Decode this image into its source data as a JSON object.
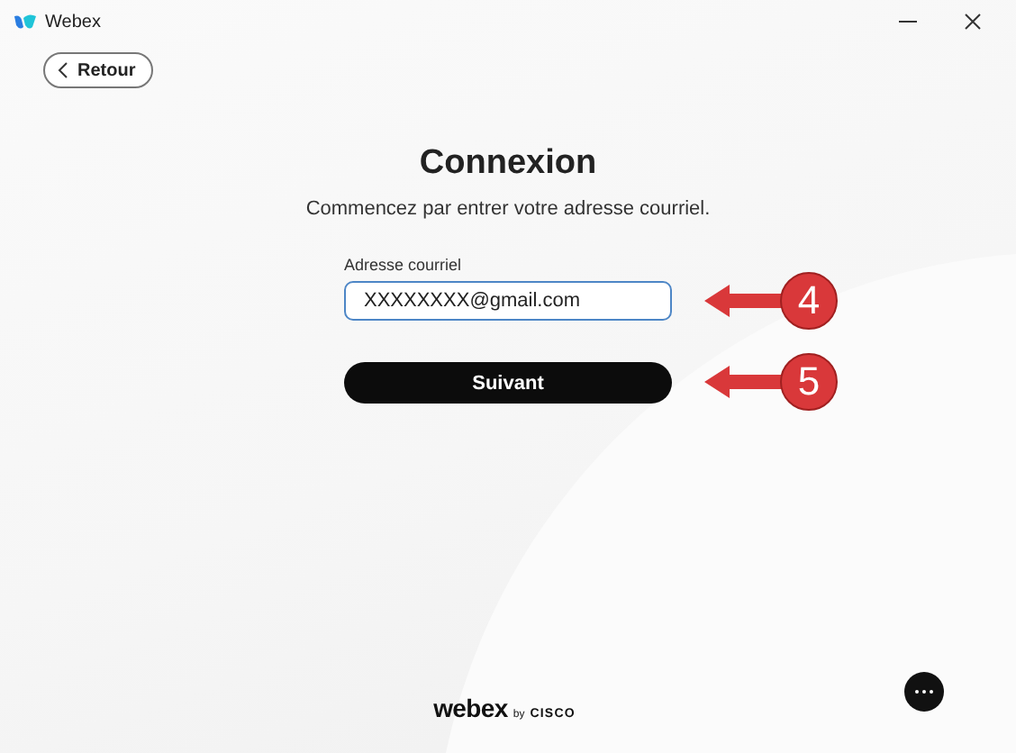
{
  "window": {
    "title": "Webex"
  },
  "back_button": {
    "label": "Retour"
  },
  "heading": "Connexion",
  "subtitle": "Commencez par entrer votre adresse courriel.",
  "email_field": {
    "label": "Adresse courriel",
    "value": "XXXXXXXX@gmail.com",
    "callout": "4"
  },
  "next_button": {
    "label": "Suivant",
    "callout": "5"
  },
  "footer": {
    "brand": "webex",
    "by": "by",
    "company": "CISCO"
  }
}
